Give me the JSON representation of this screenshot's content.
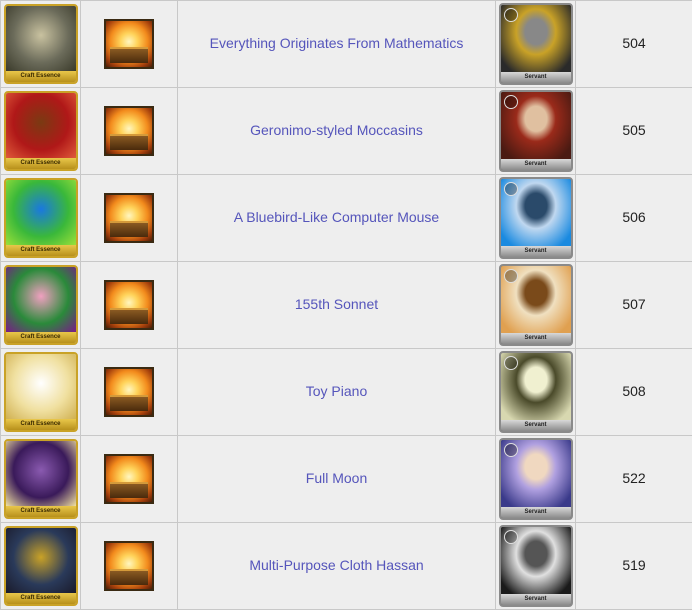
{
  "labels": {
    "craft_essence_banner": "Craft Essence",
    "servant_banner": "Servant"
  },
  "rows": [
    {
      "name": "Everything Originates From Mathematics",
      "number": "504",
      "ce_art": "stacked-books",
      "ce_colors": [
        "#6b6b5a",
        "#c9c2a0",
        "#3a3a2a"
      ],
      "servant_art": "armored-rider",
      "servant_colors": [
        "#2a2a2a",
        "#c9a227",
        "#888888"
      ]
    },
    {
      "name": "Geronimo-styled Moccasins",
      "number": "505",
      "ce_art": "moccasins",
      "ce_colors": [
        "#b01818",
        "#7a3a12",
        "#e05a3a"
      ],
      "servant_art": "geronimo",
      "servant_colors": [
        "#4a1a12",
        "#9a2a1a",
        "#e0c0a0"
      ]
    },
    {
      "name": "A Bluebird-Like Computer Mouse",
      "number": "506",
      "ce_art": "blue-mouse",
      "ce_colors": [
        "#3ab83a",
        "#1a78e0",
        "#9ae03a"
      ],
      "servant_art": "blue-hair-youth",
      "servant_colors": [
        "#1a8ae0",
        "#c0d8f0",
        "#2a4a6a"
      ]
    },
    {
      "name": "155th Sonnet",
      "number": "507",
      "ce_art": "rose-bouquet",
      "ce_colors": [
        "#2a8a3a",
        "#f0a0c0",
        "#7a1a8a"
      ],
      "servant_art": "shakespeare",
      "servant_colors": [
        "#e0a050",
        "#f0e0c0",
        "#7a4a1a"
      ]
    },
    {
      "name": "Toy Piano",
      "number": "508",
      "ce_art": "white-piano",
      "ce_colors": [
        "#f0e0a0",
        "#ffffff",
        "#d0b050"
      ],
      "servant_art": "pale-masked",
      "servant_colors": [
        "#d8d8b0",
        "#4a4a2a",
        "#f0f0d0"
      ]
    },
    {
      "name": "Full Moon",
      "number": "522",
      "ce_art": "night-moon",
      "ce_colors": [
        "#3a1a5a",
        "#8a5ab0",
        "#f0e0a0"
      ],
      "servant_art": "purple-swordsman",
      "servant_colors": [
        "#3a3a8a",
        "#b0a0e0",
        "#f0d8c0"
      ]
    },
    {
      "name": "Multi-Purpose Cloth Hassan",
      "number": "519",
      "ce_art": "dark-cloth",
      "ce_colors": [
        "#2a3a5a",
        "#c9a227",
        "#1a1a2a"
      ],
      "servant_art": "skull-mask",
      "servant_colors": [
        "#1a1a1a",
        "#e0e0e0",
        "#555555"
      ]
    }
  ]
}
